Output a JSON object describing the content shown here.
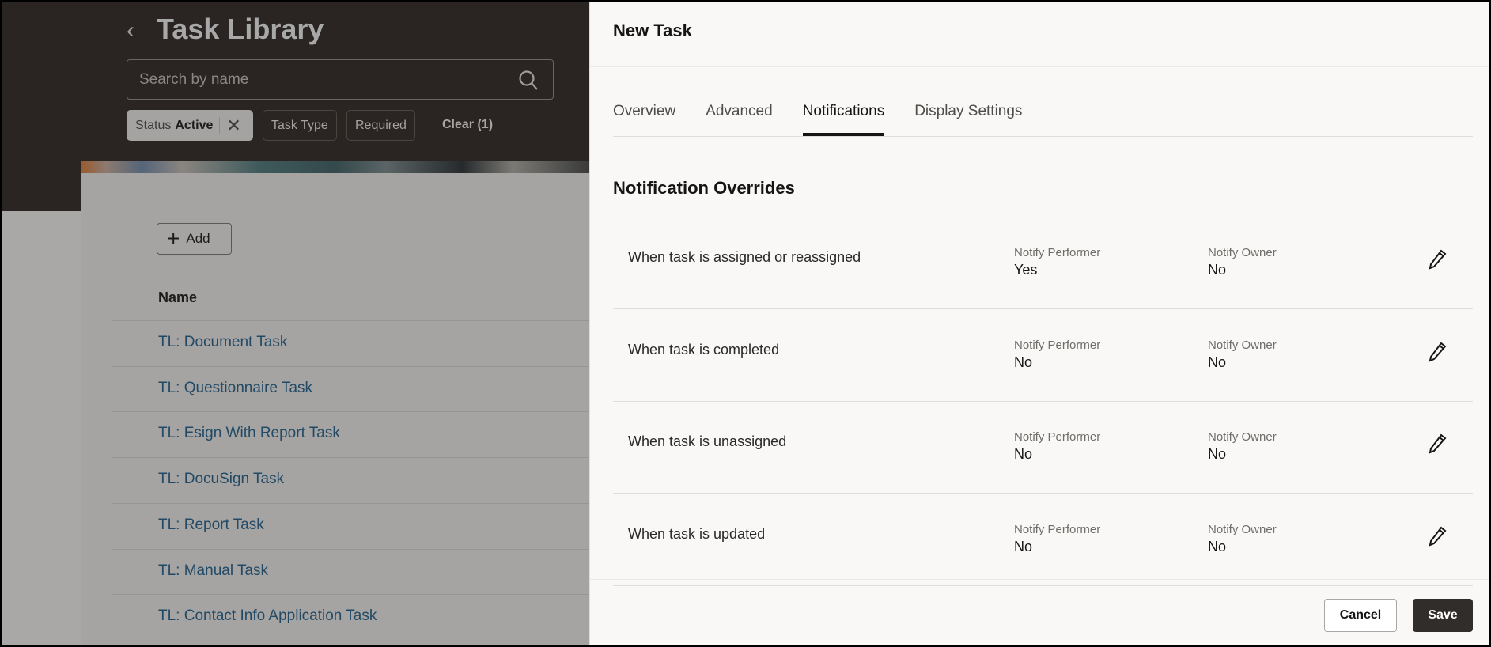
{
  "library": {
    "title": "Task Library",
    "search_placeholder": "Search by name",
    "filters": {
      "status_label": "Status",
      "status_value": "Active",
      "task_type": "Task Type",
      "required": "Required",
      "clear": "Clear (1)"
    },
    "add_label": "Add",
    "column_name": "Name",
    "tasks": [
      "TL: Document Task",
      "TL: Questionnaire Task",
      "TL: Esign With Report Task",
      "TL: DocuSign Task",
      "TL: Report Task",
      "TL: Manual Task",
      "TL: Contact Info Application Task"
    ]
  },
  "panel": {
    "title": "New Task",
    "tabs": [
      "Overview",
      "Advanced",
      "Notifications",
      "Display Settings"
    ],
    "active_tab": "Notifications",
    "section_title": "Notification Overrides",
    "rows": [
      {
        "label": "When task is assigned or reassigned",
        "performer_label": "Notify Performer",
        "performer": "Yes",
        "owner_label": "Notify Owner",
        "owner": "No"
      },
      {
        "label": "When task is completed",
        "performer_label": "Notify Performer",
        "performer": "No",
        "owner_label": "Notify Owner",
        "owner": "No"
      },
      {
        "label": "When task is unassigned",
        "performer_label": "Notify Performer",
        "performer": "No",
        "owner_label": "Notify Owner",
        "owner": "No"
      },
      {
        "label": "When task is updated",
        "performer_label": "Notify Performer",
        "performer": "No",
        "owner_label": "Notify Owner",
        "owner": "No"
      }
    ],
    "cancel": "Cancel",
    "save": "Save"
  }
}
